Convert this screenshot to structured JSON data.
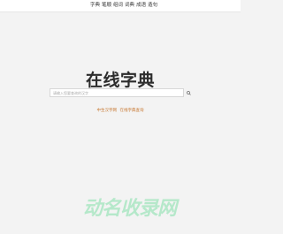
{
  "nav": {
    "items": [
      "字典",
      "笔顺",
      "组词",
      "词典",
      "成语",
      "造句"
    ]
  },
  "main": {
    "title": "在线字典",
    "search_placeholder": "请输入您要查询的汉字",
    "links": [
      "中生汉字网",
      "在线字典查询"
    ]
  },
  "watermark": {
    "text": "动名收录网"
  },
  "colors": {
    "accent": "#c87832",
    "watermark": "#2fd26f"
  }
}
